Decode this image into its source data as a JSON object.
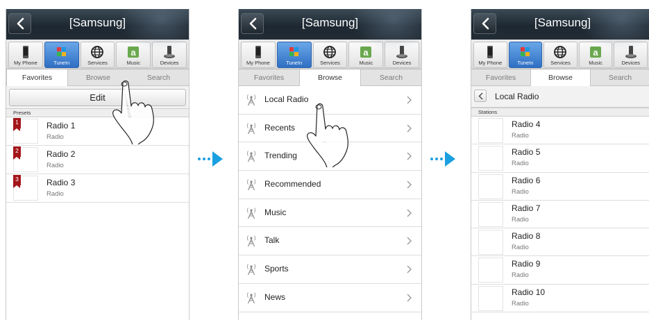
{
  "panels": [
    {
      "title": "[Samsung]",
      "sources": [
        "My Phone",
        "TuneIn",
        "Services",
        "Music",
        "Devices"
      ],
      "active_source": 1,
      "tabs": [
        "Favorites",
        "Browse",
        "Search"
      ],
      "active_tab": 0,
      "edit_label": "Edit",
      "section_label": "Presets",
      "presets": [
        {
          "number": "1",
          "name": "Radio 1",
          "sub": "Radio"
        },
        {
          "number": "2",
          "name": "Radio 2",
          "sub": "Radio"
        },
        {
          "number": "3",
          "name": "Radio 3",
          "sub": "Radio"
        }
      ]
    },
    {
      "title": "[Samsung]",
      "sources": [
        "My Phone",
        "TuneIn",
        "Services",
        "Music",
        "Devices"
      ],
      "active_source": 1,
      "tabs": [
        "Favorites",
        "Browse",
        "Search"
      ],
      "active_tab": 1,
      "browse_items": [
        "Local Radio",
        "Recents",
        "Trending",
        "Recommended",
        "Music",
        "Talk",
        "Sports",
        "News"
      ]
    },
    {
      "title": "[Samsung]",
      "sources": [
        "My Phone",
        "TuneIn",
        "Services",
        "Music",
        "Devices"
      ],
      "active_source": 1,
      "tabs": [
        "Favorites",
        "Browse",
        "Search"
      ],
      "active_tab": 1,
      "subheader": "Local Radio",
      "section_label": "Stations",
      "stations": [
        {
          "name": "Radio 4",
          "sub": "Radio"
        },
        {
          "name": "Radio 5",
          "sub": "Radio"
        },
        {
          "name": "Radio 6",
          "sub": "Radio"
        },
        {
          "name": "Radio 7",
          "sub": "Radio"
        },
        {
          "name": "Radio 8",
          "sub": "Radio"
        },
        {
          "name": "Radio 9",
          "sub": "Radio"
        },
        {
          "name": "Radio 10",
          "sub": "Radio"
        }
      ]
    }
  ],
  "colors": {
    "accent_arrow": "#1aa0e0",
    "preset_flag": "#a3161b",
    "active_source": "#3f7fd0"
  },
  "icons": [
    "back-chevron-icon",
    "phone-icon",
    "tunein-icon",
    "globe-icon",
    "amazon-icon",
    "devices-icon",
    "antenna-icon",
    "chevron-right-icon",
    "hand-pointer-icon",
    "flow-arrow-icon"
  ]
}
